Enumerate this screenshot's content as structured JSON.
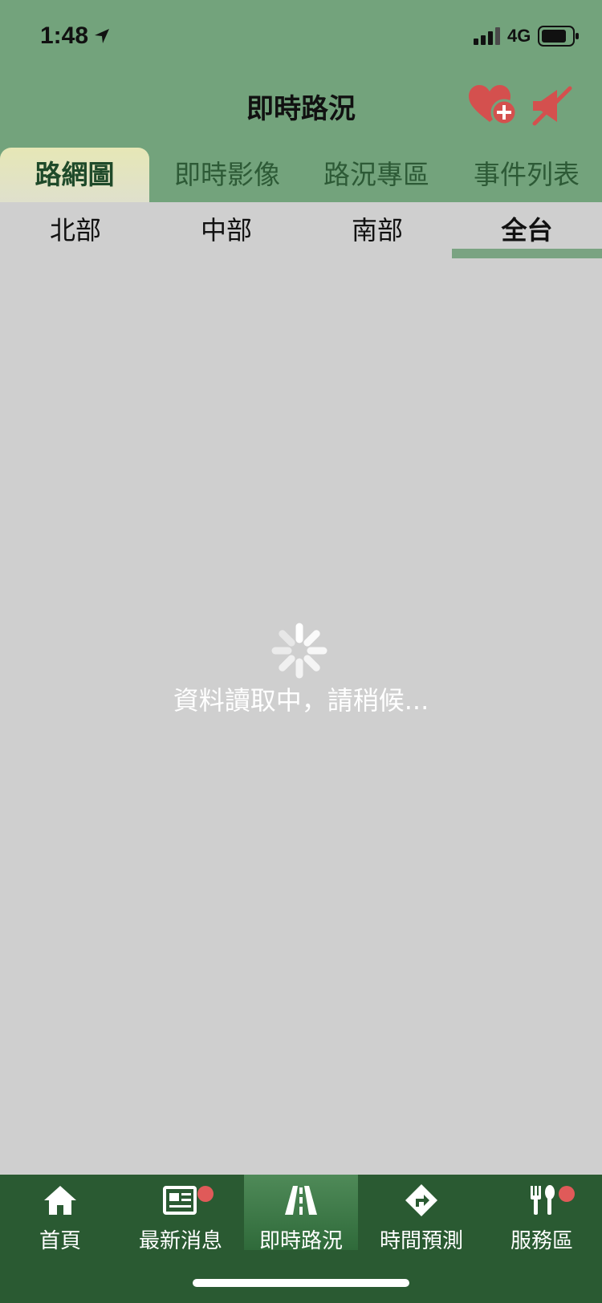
{
  "status_bar": {
    "time": "1:48",
    "network": "4G"
  },
  "header": {
    "title": "即時路況",
    "icons": [
      "heart-plus-icon",
      "mute-icon"
    ]
  },
  "main_tabs": [
    {
      "label": "路網圖",
      "active": true
    },
    {
      "label": "即時影像",
      "active": false
    },
    {
      "label": "路況專區",
      "active": false
    },
    {
      "label": "事件列表",
      "active": false
    }
  ],
  "region_tabs": [
    {
      "label": "北部",
      "active": false
    },
    {
      "label": "中部",
      "active": false
    },
    {
      "label": "南部",
      "active": false
    },
    {
      "label": "全台",
      "active": true
    }
  ],
  "loading": {
    "text": "資料讀取中，請稍候..."
  },
  "bottom_nav": [
    {
      "label": "首頁",
      "icon": "home-icon",
      "badge": false,
      "active": false
    },
    {
      "label": "最新消息",
      "icon": "news-icon",
      "badge": true,
      "active": false
    },
    {
      "label": "即時路況",
      "icon": "road-icon",
      "badge": false,
      "active": true
    },
    {
      "label": "時間預測",
      "icon": "route-sign-icon",
      "badge": false,
      "active": false
    },
    {
      "label": "服務區",
      "icon": "dining-icon",
      "badge": true,
      "active": false
    }
  ],
  "colors": {
    "header_bg": "#73a37c",
    "content_bg": "#cfcfcf",
    "bottom_nav_bg": "#2a5a32",
    "badge": "#e05a59",
    "icon_red": "#d4504e"
  }
}
